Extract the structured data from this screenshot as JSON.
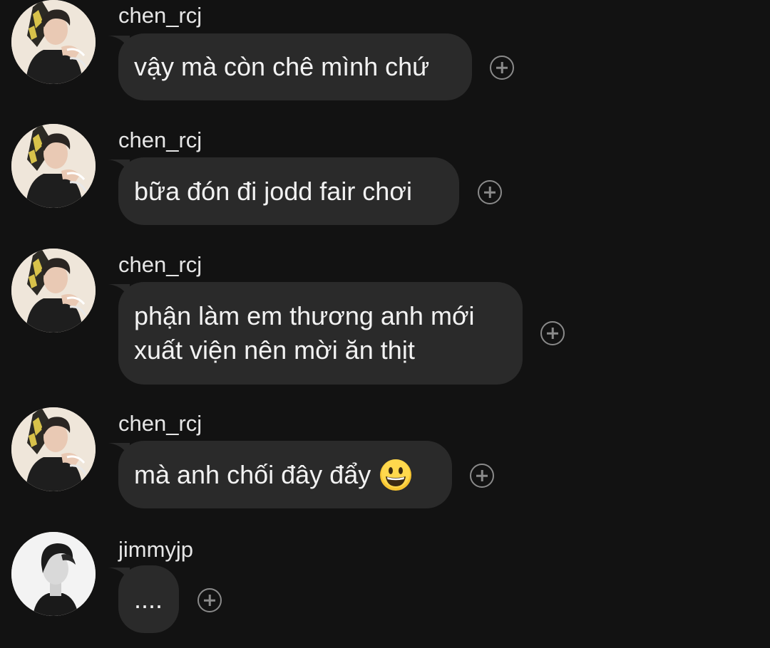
{
  "messages": [
    {
      "username": "chen_rcj",
      "avatar_icon": "user-avatar-chen",
      "text": "vậy mà còn chê mình chứ",
      "react_icon": "add-reaction-icon"
    },
    {
      "username": "chen_rcj",
      "avatar_icon": "user-avatar-chen",
      "text": "bữa đón đi jodd fair chơi",
      "react_icon": "add-reaction-icon"
    },
    {
      "username": "chen_rcj",
      "avatar_icon": "user-avatar-chen",
      "text_line1": "phận làm em thương anh mới",
      "text_line2": "xuất viện nên mời ăn thịt",
      "react_icon": "add-reaction-icon"
    },
    {
      "username": "chen_rcj",
      "avatar_icon": "user-avatar-chen",
      "text": "mà anh chối đây đẩy",
      "emoji": "grinning-face-emoji",
      "react_icon": "add-reaction-icon"
    },
    {
      "username": "jimmyjp",
      "avatar_icon": "user-avatar-jimmy",
      "text": "....",
      "react_icon": "add-reaction-icon"
    }
  ],
  "colors": {
    "background": "#121212",
    "bubble": "#2a2a2a",
    "text": "#f2f2f2",
    "icon": "#8a8a8a"
  }
}
